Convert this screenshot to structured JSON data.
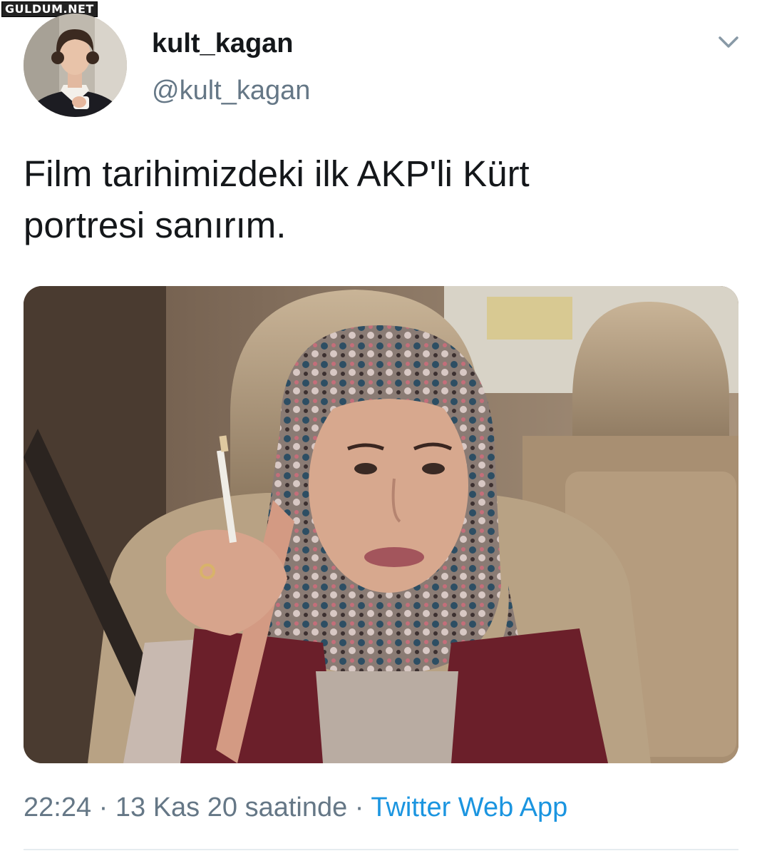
{
  "watermark": "GULDUM.NET",
  "tweet": {
    "display_name": "kult_kagan",
    "handle": "@kult_kagan",
    "text_line1": "Film tarihimizdeki ilk AKP'li Kürt",
    "text_line2": "portresi sanırım.",
    "time": "22:24",
    "separator": " · ",
    "date": "13 Kas 20 saatinde",
    "source": "Twitter Web App"
  },
  "icons": {
    "menu": "chevron-down-icon"
  },
  "colors": {
    "text_primary": "#14171a",
    "text_secondary": "#657786",
    "link": "#1b95e0"
  }
}
